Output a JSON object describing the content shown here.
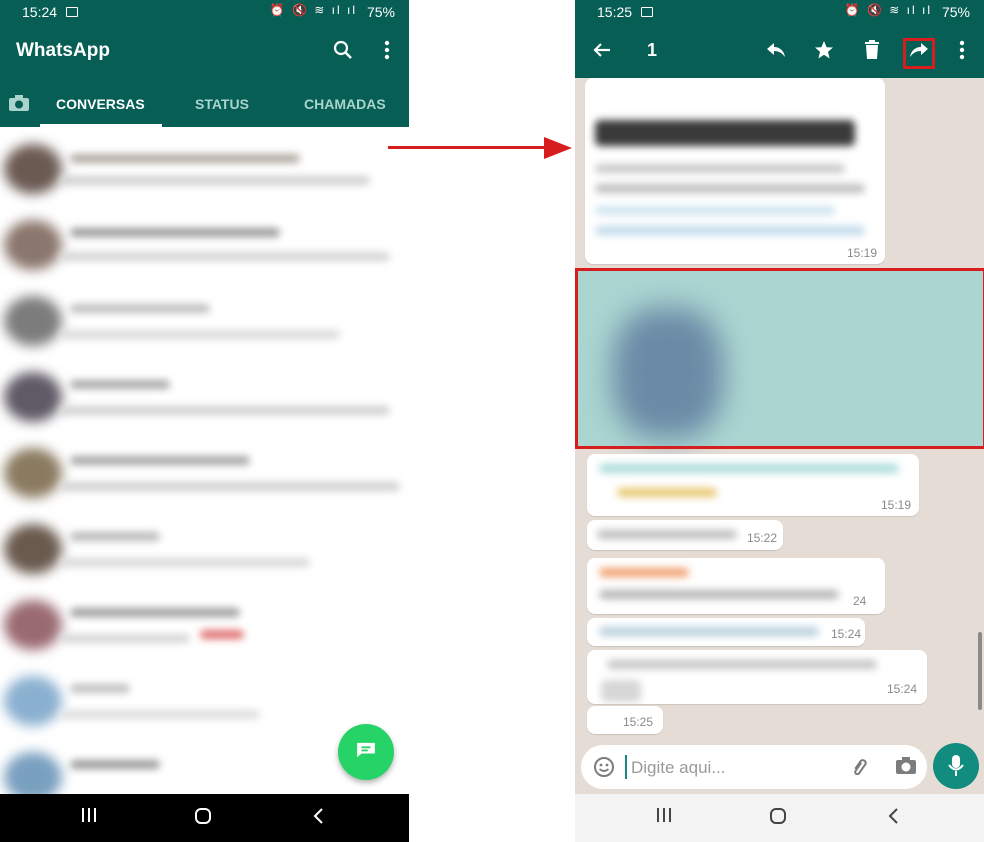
{
  "left_screen": {
    "status_bar": {
      "time": "15:24",
      "battery": "75%",
      "icons": "⏰ 🔇 ≋ ıl ıl"
    },
    "app_title": "WhatsApp",
    "tabs": [
      {
        "label": "CONVERSAS",
        "active": true
      },
      {
        "label": "STATUS",
        "active": false
      },
      {
        "label": "CHAMADAS",
        "active": false
      }
    ],
    "chat_rows_blurred": 9
  },
  "right_screen": {
    "status_bar": {
      "time": "15:25",
      "battery": "75%",
      "icons": "⏰ 🔇 ≋ ıl ıl"
    },
    "selection_count": "1",
    "message_times": [
      "15:19",
      "15:19",
      "15:22",
      "24",
      "15:24",
      "15:24",
      "15:25"
    ],
    "input_placeholder": "Digite aqui..."
  },
  "colors": {
    "header": "#075e54",
    "fab": "#25d366",
    "mic": "#128c7e",
    "selected": "#aad5d1",
    "highlight": "#d71e1e",
    "chat_bg": "#e5ddd5"
  },
  "icons": {
    "camera": "camera-icon",
    "search": "search-icon",
    "menu": "more-vert-icon",
    "back": "arrow-back-icon",
    "reply": "reply-icon",
    "star": "star-icon",
    "delete": "trash-icon",
    "forward": "forward-icon",
    "emoji": "emoji-icon",
    "attach": "paperclip-icon",
    "mic": "mic-icon"
  }
}
